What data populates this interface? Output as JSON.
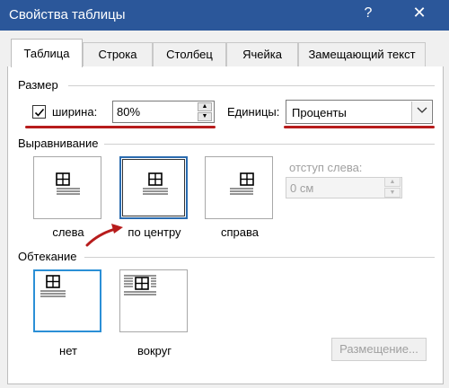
{
  "window": {
    "title": "Свойства таблицы",
    "help_glyph": "?",
    "close_glyph": "✕"
  },
  "tabs": [
    {
      "label": "Таблица",
      "active": true
    },
    {
      "label": "Строка",
      "active": false
    },
    {
      "label": "Столбец",
      "active": false
    },
    {
      "label": "Ячейка",
      "active": false
    },
    {
      "label": "Замещающий текст",
      "active": false
    }
  ],
  "size": {
    "section": "Размер",
    "width_label": "ширина:",
    "width_checked": true,
    "width_value": "80%",
    "units_label": "Единицы:",
    "units_value": "Проценты"
  },
  "alignment": {
    "section": "Выравнивание",
    "options": [
      {
        "label": "слева",
        "selected": false
      },
      {
        "label": "по центру",
        "selected": true
      },
      {
        "label": "справа",
        "selected": false
      }
    ],
    "indent_label": "отступ слева:",
    "indent_value": "0 см"
  },
  "wrapping": {
    "section": "Обтекание",
    "options": [
      {
        "label": "нет",
        "selected": true
      },
      {
        "label": "вокруг",
        "selected": false
      }
    ],
    "placement_label": "Размещение..."
  },
  "colors": {
    "titlebar": "#2b579a",
    "annotation_red": "#b71c1c",
    "selection_blue": "#2b6cb0"
  }
}
